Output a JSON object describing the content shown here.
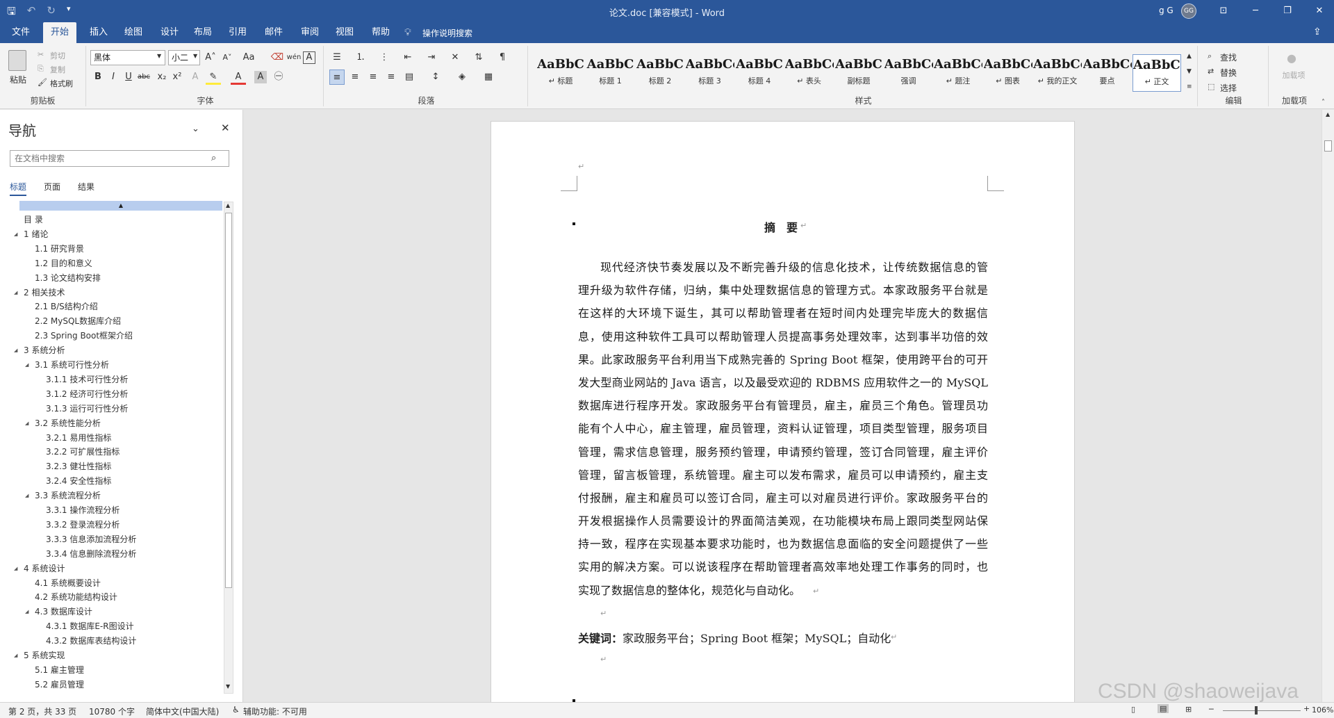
{
  "title_bar": {
    "title": "论文.doc [兼容模式] - Word",
    "user": "g G",
    "avatar": "GG",
    "save_icon": "save-icon",
    "undo_icon": "undo-icon",
    "redo_icon": "redo-icon",
    "customize_icon": "qat-customize-icon",
    "window_controls": [
      "ribbon-display-icon",
      "minimize-icon",
      "restore-icon",
      "close-icon"
    ]
  },
  "menu": {
    "tabs": [
      "文件",
      "开始",
      "插入",
      "绘图",
      "设计",
      "布局",
      "引用",
      "邮件",
      "审阅",
      "视图",
      "帮助"
    ],
    "active": "开始",
    "tell_me": "操作说明搜索",
    "tell_me_icon": "lightbulb-icon"
  },
  "ribbon": {
    "clipboard": {
      "label": "剪贴板",
      "paste": "粘贴",
      "cut": "剪切",
      "copy": "复制",
      "format_painter": "格式刷"
    },
    "font": {
      "label": "字体",
      "font_name": "黑体",
      "font_size": "小二",
      "change_case": "Aa",
      "phonetic": "wén",
      "bold": "B",
      "italic": "I",
      "underline": "U",
      "strike": "abc",
      "subscript": "x₂",
      "superscript": "x²"
    },
    "paragraph": {
      "label": "段落"
    },
    "styles": {
      "label": "样式",
      "items": [
        {
          "preview": "AaBbC",
          "name": "↵ 标题"
        },
        {
          "preview": "AaBbC",
          "name": "标题 1"
        },
        {
          "preview": "AaBbC",
          "name": "标题 2"
        },
        {
          "preview": "AaBbCcl",
          "name": "标题 3"
        },
        {
          "preview": "AaBbC",
          "name": "标题 4"
        },
        {
          "preview": "AaBbCcDc",
          "name": "↵ 表头"
        },
        {
          "preview": "AaBbC",
          "name": "副标题"
        },
        {
          "preview": "AaBbCcL",
          "name": "强调"
        },
        {
          "preview": "AaBbCcDd",
          "name": "↵ 题注"
        },
        {
          "preview": "AaBbCcDc",
          "name": "↵ 图表"
        },
        {
          "preview": "AaBbCcDc",
          "name": "↵ 我的正文"
        },
        {
          "preview": "AaBbCcl",
          "name": "要点"
        },
        {
          "preview": "AaBbCcI",
          "name": "↵ 正文"
        }
      ]
    },
    "editing": {
      "label": "编辑",
      "find": "查找",
      "replace": "替换",
      "select": "选择"
    },
    "addins": {
      "label": "加载项",
      "btn": "加载项"
    }
  },
  "nav": {
    "title": "导航",
    "search_placeholder": "在文档中搜索",
    "tabs": [
      "标题",
      "页面",
      "结果"
    ],
    "active_tab": "标题",
    "items": [
      {
        "text": "目 录",
        "level": 0,
        "arrow": ""
      },
      {
        "text": "1 绪论",
        "level": 0,
        "arrow": "◢"
      },
      {
        "text": "1.1 研究背景",
        "level": 1,
        "arrow": ""
      },
      {
        "text": "1.2 目的和意义",
        "level": 1,
        "arrow": ""
      },
      {
        "text": "1.3 论文结构安排",
        "level": 1,
        "arrow": ""
      },
      {
        "text": "2 相关技术",
        "level": 0,
        "arrow": "◢"
      },
      {
        "text": "2.1 B/S结构介绍",
        "level": 1,
        "arrow": ""
      },
      {
        "text": "2.2 MySQL数据库介绍",
        "level": 1,
        "arrow": ""
      },
      {
        "text": "2.3 Spring Boot框架介绍",
        "level": 1,
        "arrow": ""
      },
      {
        "text": "3 系统分析",
        "level": 0,
        "arrow": "◢"
      },
      {
        "text": "3.1 系统可行性分析",
        "level": 1,
        "arrow": "◢"
      },
      {
        "text": "3.1.1 技术可行性分析",
        "level": 2,
        "arrow": ""
      },
      {
        "text": "3.1.2 经济可行性分析",
        "level": 2,
        "arrow": ""
      },
      {
        "text": "3.1.3 运行可行性分析",
        "level": 2,
        "arrow": ""
      },
      {
        "text": "3.2 系统性能分析",
        "level": 1,
        "arrow": "◢"
      },
      {
        "text": "3.2.1 易用性指标",
        "level": 2,
        "arrow": ""
      },
      {
        "text": "3.2.2 可扩展性指标",
        "level": 2,
        "arrow": ""
      },
      {
        "text": "3.2.3 健壮性指标",
        "level": 2,
        "arrow": ""
      },
      {
        "text": "3.2.4 安全性指标",
        "level": 2,
        "arrow": ""
      },
      {
        "text": "3.3 系统流程分析",
        "level": 1,
        "arrow": "◢"
      },
      {
        "text": "3.3.1 操作流程分析",
        "level": 2,
        "arrow": ""
      },
      {
        "text": "3.3.2 登录流程分析",
        "level": 2,
        "arrow": ""
      },
      {
        "text": "3.3.3 信息添加流程分析",
        "level": 2,
        "arrow": ""
      },
      {
        "text": "3.3.4 信息删除流程分析",
        "level": 2,
        "arrow": ""
      },
      {
        "text": "4 系统设计",
        "level": 0,
        "arrow": "◢"
      },
      {
        "text": "4.1 系统概要设计",
        "level": 1,
        "arrow": ""
      },
      {
        "text": "4.2 系统功能结构设计",
        "level": 1,
        "arrow": ""
      },
      {
        "text": "4.3 数据库设计",
        "level": 1,
        "arrow": "◢"
      },
      {
        "text": "4.3.1 数据库E-R图设计",
        "level": 2,
        "arrow": ""
      },
      {
        "text": "4.3.2 数据库表结构设计",
        "level": 2,
        "arrow": ""
      },
      {
        "text": "5 系统实现",
        "level": 0,
        "arrow": "◢"
      },
      {
        "text": "5.1 雇主管理",
        "level": 1,
        "arrow": ""
      },
      {
        "text": "5.2 雇员管理",
        "level": 1,
        "arrow": ""
      }
    ]
  },
  "document": {
    "top_mark": "↵",
    "heading": "摘　要",
    "lines": [
      "现代经济快节奏发展以及不断完善升级的信息化技术，让传统数据信息的管",
      "理升级为软件存储，归纳，集中处理数据信息的管理方式。本家政服务平台就是",
      "在这样的大环境下诞生，其可以帮助管理者在短时间内处理完毕庞大的数据信",
      "息，使用这种软件工具可以帮助管理人员提高事务处理效率，达到事半功倍的效",
      "果。此家政服务平台利用当下成熟完善的 Spring  Boot 框架，使用跨平台的可开",
      "发大型商业网站的 Java 语言，以及最受欢迎的 RDBMS 应用软件之一的 MySQL",
      "数据库进行程序开发。家政服务平台有管理员，雇主，雇员三个角色。管理员功",
      "能有个人中心，雇主管理，雇员管理，资料认证管理，项目类型管理，服务项目",
      "管理，需求信息管理，服务预约管理，申请预约管理，签订合同管理，雇主评价",
      "管理，留言板管理，系统管理。雇主可以发布需求，雇员可以申请预约，雇主支",
      "付报酬，雇主和雇员可以签订合同，雇主可以对雇员进行评价。家政服务平台的",
      "开发根据操作人员需要设计的界面简洁美观，在功能模块布局上跟同类型网站保",
      "持一致，程序在实现基本要求功能时，也为数据信息面临的安全问题提供了一些",
      "实用的解决方案。可以说该程序在帮助管理者高效率地处理工作事务的同时，也",
      "实现了数据信息的整体化，规范化与自动化。"
    ],
    "pilcrow": "↵",
    "keywords_label": "关键词：",
    "keywords": "家政服务平台；Spring Boot 框架；MySQL；自动化"
  },
  "status": {
    "page": "第 2 页，共 33 页",
    "words": "10780 个字",
    "language": "简体中文(中国大陆)",
    "accessibility": "辅助功能: 不可用",
    "zoom": "106%",
    "watermark": "CSDN @shaoweijava"
  }
}
